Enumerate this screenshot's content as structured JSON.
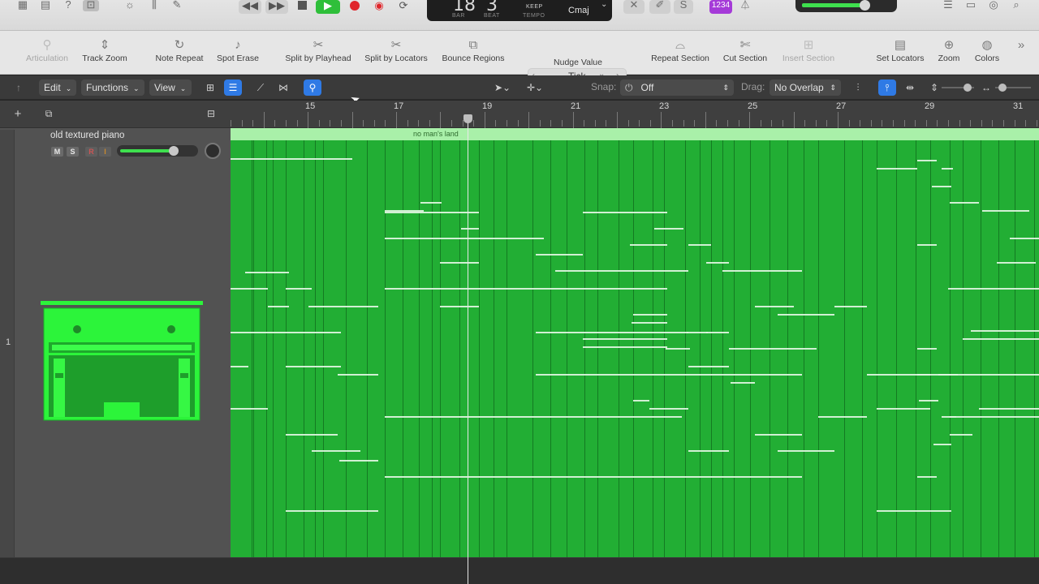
{
  "transport": {
    "bar": "18",
    "beat": "3",
    "bar_label": "BAR",
    "beat_label": "BEAT",
    "tempo_mode": "KEEP",
    "tempo_label": "TEMPO",
    "key": "Cmaj",
    "count_in": "1234"
  },
  "toolbar": {
    "articulation": "Articulation",
    "track_zoom": "Track Zoom",
    "note_repeat": "Note Repeat",
    "spot_erase": "Spot Erase",
    "split_by_playhead": "Split by Playhead",
    "split_by_locators": "Split by Locators",
    "bounce_regions": "Bounce Regions",
    "nudge_value": "Nudge Value",
    "nudge_selected": "Tick",
    "repeat_section": "Repeat Section",
    "cut_section": "Cut Section",
    "insert_section": "Insert Section",
    "set_locators": "Set Locators",
    "zoom": "Zoom",
    "colors": "Colors"
  },
  "menubar": {
    "edit": "Edit",
    "functions": "Functions",
    "view": "View",
    "snap_label": "Snap:",
    "snap_value": "Off",
    "drag_label": "Drag:",
    "drag_value": "No Overlap"
  },
  "track": {
    "number": "1",
    "name": "old textured piano",
    "mute": "M",
    "solo": "S",
    "record": "R",
    "input": "I",
    "volume_level": 0.8
  },
  "ruler": {
    "bars": [
      "15",
      "17",
      "19",
      "21",
      "23",
      "25",
      "27",
      "29",
      "31"
    ]
  },
  "region": {
    "name": "no man's land"
  },
  "colors": {
    "region": "#22ae34",
    "region_header": "#a9f0a9",
    "accent": "#2f7ae5",
    "play": "#2fbf3a",
    "record": "#e0262b"
  }
}
